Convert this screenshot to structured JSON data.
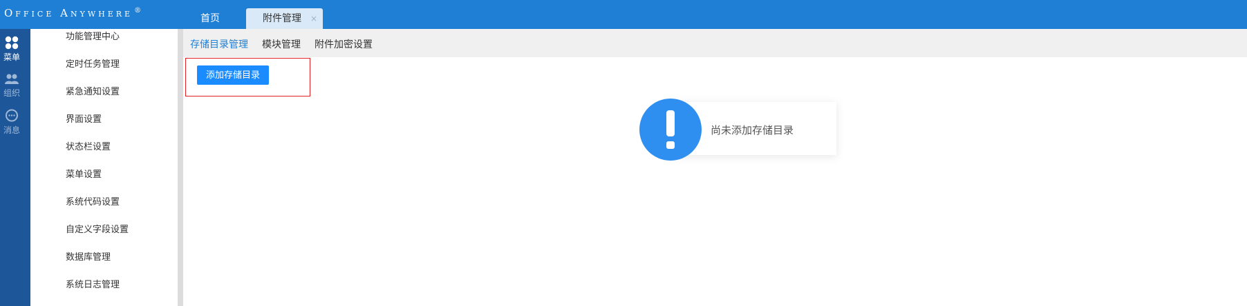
{
  "header": {
    "logo_text": "Office Anywhere",
    "logo_mark": "®",
    "tabs": [
      {
        "label": "首页",
        "active": false
      },
      {
        "label": "附件管理",
        "active": true,
        "close": "×"
      }
    ]
  },
  "rail": {
    "items": [
      {
        "icon": "grid-icon",
        "label": "菜单",
        "active": true
      },
      {
        "icon": "users-icon",
        "label": "组织",
        "active": false
      },
      {
        "icon": "chat-icon",
        "label": "消息",
        "active": false
      }
    ]
  },
  "menu": {
    "items": [
      "功能管理中心",
      "定时任务管理",
      "紧急通知设置",
      "界面设置",
      "状态栏设置",
      "菜单设置",
      "系统代码设置",
      "自定义字段设置",
      "数据库管理",
      "系统日志管理"
    ]
  },
  "subnav": {
    "items": [
      {
        "label": "存储目录管理",
        "active": true
      },
      {
        "label": "模块管理",
        "active": false
      },
      {
        "label": "附件加密设置",
        "active": false
      }
    ]
  },
  "main": {
    "add_button_label": "添加存储目录",
    "empty_message": "尚未添加存储目录",
    "empty_icon": "exclamation-icon"
  },
  "colors": {
    "topbar": "#1f7fd4",
    "rail": "#1e5799",
    "accent": "#1a8cff",
    "highlight_border": "#e02020"
  }
}
